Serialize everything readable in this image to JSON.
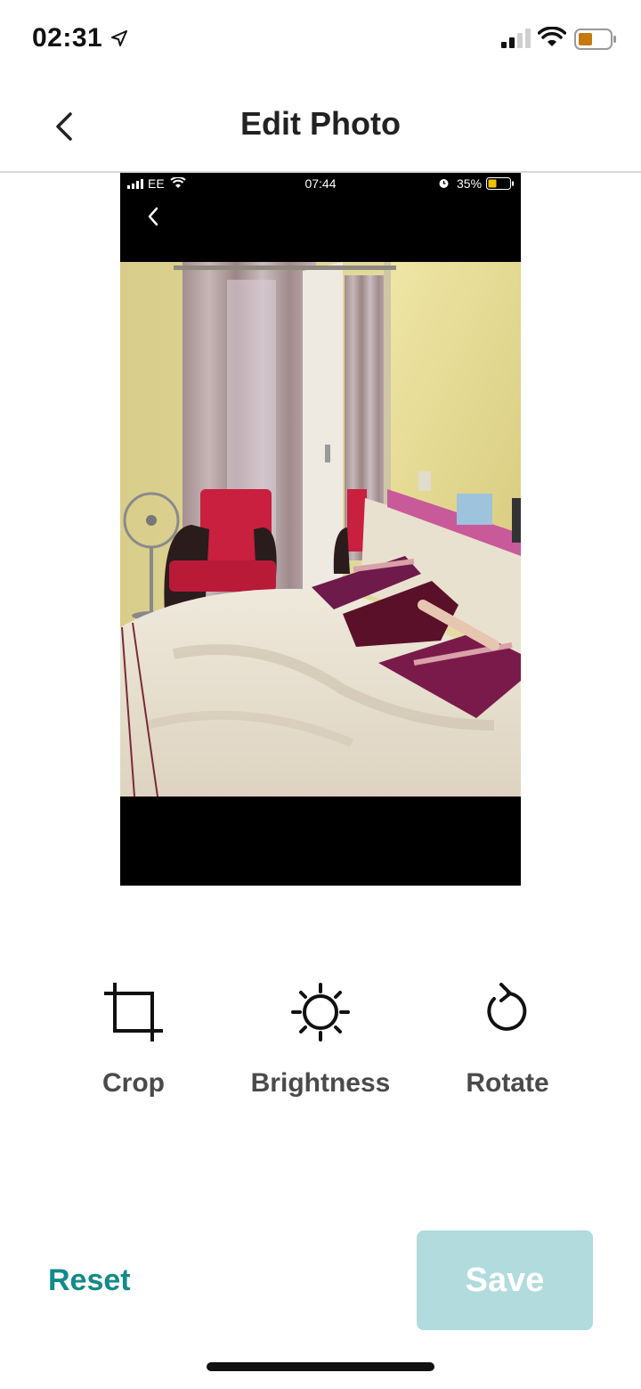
{
  "status_bar": {
    "time": "02:31",
    "icons": [
      "location-arrow-icon",
      "signal-icon",
      "wifi-icon",
      "battery-icon"
    ],
    "battery_color": "#c47a0f"
  },
  "nav": {
    "title": "Edit Photo",
    "back_icon": "chevron-left-icon"
  },
  "photo": {
    "screenshot_status": {
      "carrier": "EE",
      "time": "07:44",
      "battery_percent": "35%"
    },
    "subject": "bedroom"
  },
  "tools": [
    {
      "label": "Crop",
      "icon": "crop-icon"
    },
    {
      "label": "Brightness",
      "icon": "brightness-icon"
    },
    {
      "label": "Rotate",
      "icon": "rotate-icon"
    }
  ],
  "actions": {
    "reset_label": "Reset",
    "save_label": "Save"
  },
  "colors": {
    "accent": "#138a8a",
    "save_disabled_bg": "#b2dbdd",
    "tool_label": "#4a4a4a"
  }
}
